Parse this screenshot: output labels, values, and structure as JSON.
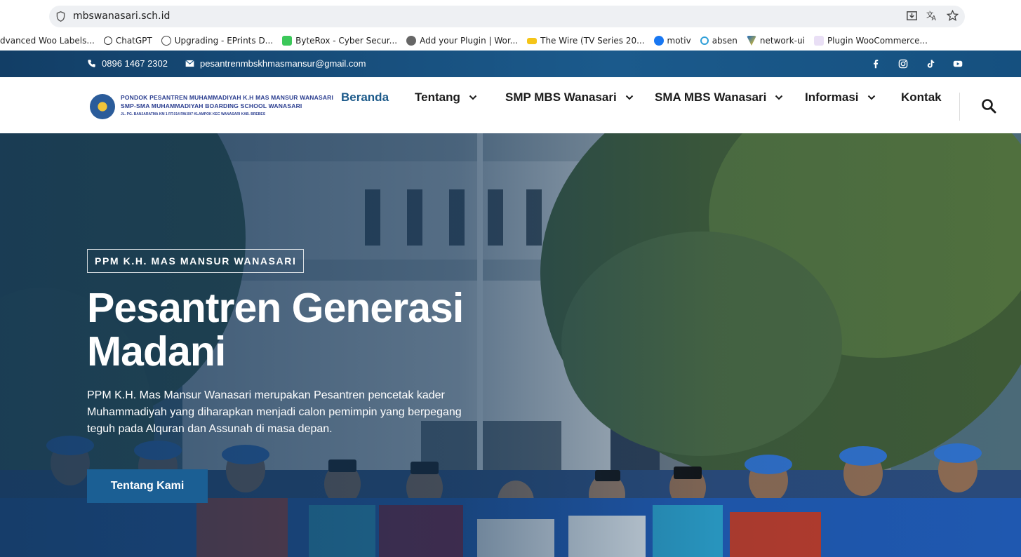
{
  "browser": {
    "url": "mbswanasari.sch.id",
    "bookmarks": [
      {
        "label": "dvanced Woo Labels...",
        "icon": "woo-labels-icon"
      },
      {
        "label": "ChatGPT",
        "icon": "chatgpt-icon"
      },
      {
        "label": "Upgrading - EPrints D...",
        "icon": "globe-icon"
      },
      {
        "label": "ByteRox - Cyber Secur...",
        "icon": "byterox-icon"
      },
      {
        "label": "Add your Plugin | Wor...",
        "icon": "wordpress-icon"
      },
      {
        "label": "The Wire (TV Series 20...",
        "icon": "imdb-icon"
      },
      {
        "label": "motiv",
        "icon": "facebook-icon"
      },
      {
        "label": "absen",
        "icon": "absen-icon"
      },
      {
        "label": "network-ui",
        "icon": "vuetify-icon"
      },
      {
        "label": "Plugin WooCommerce...",
        "icon": "woocommerce-icon"
      }
    ]
  },
  "topbar": {
    "phone": "0896 1467 2302",
    "email": "pesantrenmbskhmasmansur@gmail.com",
    "social": [
      "facebook-icon",
      "instagram-icon",
      "tiktok-icon",
      "youtube-icon"
    ]
  },
  "header": {
    "logo": {
      "line1": "PONDOK PESANTREN MUHAMMADIYAH K.H MAS MANSUR WANASARI",
      "line2": "SMP-SMA MUHAMMADIYAH BOARDING SCHOOL WANASARI",
      "line3": "JL. PG. BANJARATMA KM 1 RT.014 RW.007 KLAMPOK KEC WANASARI KAB. BREBES"
    },
    "nav": [
      {
        "label": "Beranda",
        "active": true,
        "dropdown": false
      },
      {
        "label": "Tentang",
        "active": false,
        "dropdown": true
      },
      {
        "label": "SMP MBS Wanasari",
        "active": false,
        "dropdown": true
      },
      {
        "label": "SMA MBS Wanasari",
        "active": false,
        "dropdown": true
      },
      {
        "label": "Informasi",
        "active": false,
        "dropdown": true
      },
      {
        "label": "Kontak",
        "active": false,
        "dropdown": false
      }
    ]
  },
  "hero": {
    "badge": "PPM K.H. MAS MANSUR WANASARI",
    "title_line1": "Pesantren Generasi",
    "title_line2": "Madani",
    "description": "PPM K.H. Mas Mansur Wanasari merupakan Pesantren pencetak kader Muhammadiyah yang diharapkan menjadi calon pemimpin yang berpegang teguh pada Alquran dan Assunah di masa depan.",
    "cta": "Tentang Kami"
  },
  "colors": {
    "brand": "#1b5f94",
    "topbar": "#15507f",
    "nav_active": "#1c5a8a"
  }
}
